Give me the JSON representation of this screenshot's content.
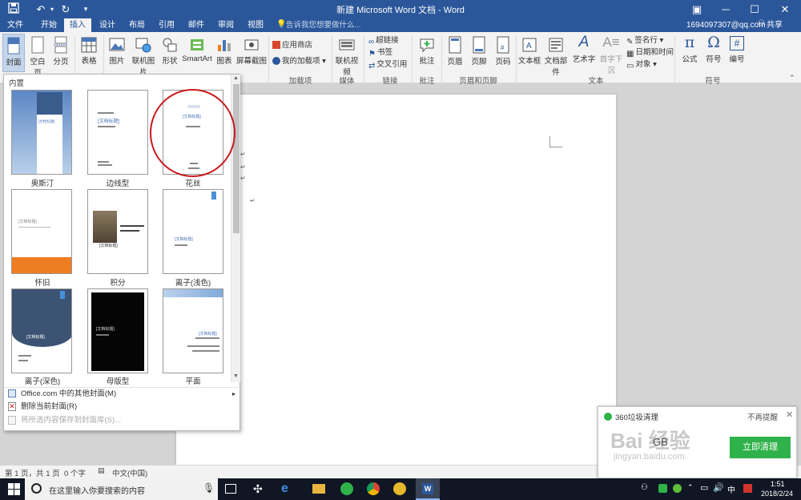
{
  "titlebar": {
    "title": "新建 Microsoft Word 文档 - Word",
    "save_icon": "save-icon",
    "undo_icon": "undo-icon",
    "redo_icon": "redo-icon",
    "customize_icon": "customize-icon",
    "window_controls": {
      "ribbon_display": "▣",
      "minimize": "─",
      "maximize": "☐",
      "close": "✕"
    }
  },
  "tabs": [
    "文件",
    "开始",
    "插入",
    "设计",
    "布局",
    "引用",
    "邮件",
    "审阅",
    "视图"
  ],
  "active_tab": "插入",
  "tellme": "告诉我您想要做什么...",
  "account": "1694097307@qq.com",
  "share": "共享",
  "ribbon": {
    "pages": [
      "封面",
      "空白页",
      "分页"
    ],
    "table": "表格",
    "illustrations": [
      "图片",
      "联机图片",
      "形状",
      "SmartArt",
      "图表",
      "屏幕截图"
    ],
    "addins": [
      "应用商店",
      "我的加载项"
    ],
    "addins_group": "加载项",
    "media": "联机视频",
    "media_group": "媒体",
    "links": [
      "超链接",
      "书签",
      "交叉引用"
    ],
    "links_group": "链接",
    "comment": "批注",
    "comment_group": "批注",
    "header_footer": [
      "页眉",
      "页脚",
      "页码"
    ],
    "header_footer_group": "页眉和页脚",
    "text_items": [
      "文本框",
      "文档部件",
      "艺术字",
      "首字下沉"
    ],
    "text_side": [
      "签名行",
      "日期和时间",
      "对象"
    ],
    "text_group": "文本",
    "symbols": [
      "公式",
      "符号",
      "编号"
    ],
    "symbols_group": "符号"
  },
  "gallery": {
    "title": "内置",
    "thumb_title_text": "[文档标题]",
    "items": [
      {
        "label": "奥斯汀"
      },
      {
        "label": "边线型"
      },
      {
        "label": "花丝"
      },
      {
        "label": "怀旧"
      },
      {
        "label": "积分"
      },
      {
        "label": "离子(浅色)"
      },
      {
        "label": "离子(深色)"
      },
      {
        "label": "母版型"
      },
      {
        "label": "平面"
      }
    ],
    "menu": [
      {
        "label": "Office.com 中的其他封面(M)",
        "enabled": true
      },
      {
        "label": "删除当前封面(R)",
        "enabled": true
      },
      {
        "label": "将所选内容保存到封面库(S)...",
        "enabled": false
      }
    ]
  },
  "statusbar": {
    "page": "第 1 页，共 1 页",
    "words": "0 个字",
    "language": "中文(中国)"
  },
  "taskbar": {
    "search_placeholder": "在这里输入你要搜索的内容",
    "ime": "中",
    "time": "1:51",
    "date": "2018/2/24"
  },
  "popup": {
    "title": "360垃圾清理",
    "dismiss": "不再提醒",
    "size_text": "GB",
    "action": "立即清理"
  },
  "watermark": {
    "main": "Bai 经验",
    "url": "jingyan.baidu.com"
  },
  "colors": {
    "word_blue": "#2b579a",
    "accent_red": "#c8191d",
    "green": "#2fb24a",
    "orange": "#ef7d22"
  }
}
